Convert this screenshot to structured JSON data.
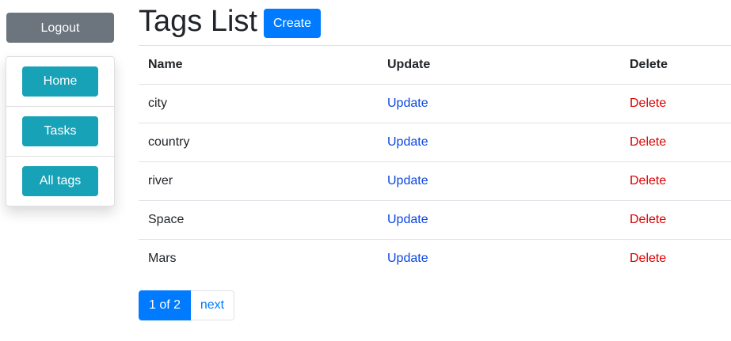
{
  "sidebar": {
    "logout_label": "Logout",
    "nav_items": [
      {
        "label": "Home"
      },
      {
        "label": "Tasks"
      },
      {
        "label": "All tags"
      }
    ]
  },
  "main": {
    "title": "Tags List",
    "create_label": "Create",
    "table": {
      "headers": [
        "Name",
        "Update",
        "Delete"
      ],
      "rows": [
        {
          "name": "city",
          "update": "Update",
          "delete": "Delete"
        },
        {
          "name": "country",
          "update": "Update",
          "delete": "Delete"
        },
        {
          "name": "river",
          "update": "Update",
          "delete": "Delete"
        },
        {
          "name": "Space",
          "update": "Update",
          "delete": "Delete"
        },
        {
          "name": "Mars",
          "update": "Update",
          "delete": "Delete"
        }
      ]
    },
    "pagination": {
      "current_label": "1 of 2",
      "next_label": "next"
    }
  },
  "colors": {
    "primary": "#007bff",
    "secondary": "#6c757d",
    "info": "#17a2b8",
    "update_link": "#0d47e0",
    "delete_link": "#dc0000"
  }
}
